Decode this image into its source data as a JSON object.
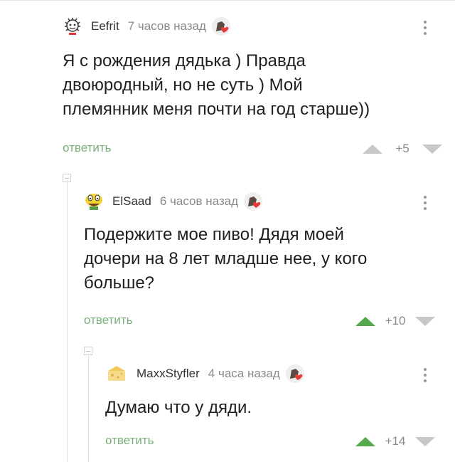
{
  "comments": [
    {
      "author": "Eefrit",
      "time": "7 часов назад",
      "text_lines": [
        "Я с рождения дядька ) Правда",
        "двоюродный, но не суть ) Мой",
        "племянник меня почти на год старше))"
      ],
      "reply_label": "ответить",
      "score": "+5",
      "upvoted": false
    },
    {
      "author": "ElSaad",
      "time": "6 часов назад",
      "text_lines": [
        "Подержите мое пиво! Дядя моей",
        "дочери на 8 лет младше нее, у кого",
        "больше?"
      ],
      "reply_label": "ответить",
      "score": "+10",
      "upvoted": true
    },
    {
      "author": "MaxxStyfler",
      "time": "4 часа назад",
      "text_lines": [
        "Думаю что у дяди."
      ],
      "reply_label": "ответить",
      "score": "+14",
      "upvoted": true
    }
  ],
  "icons": {
    "avatar_1": "avatar-icon",
    "badge": "heart-badge-icon",
    "more": "more-vertical-icon",
    "up": "upvote-arrow-icon",
    "down": "downvote-arrow-icon"
  },
  "colors": {
    "reply": "#7bb07a",
    "upvote_active": "#56a84c",
    "vote_inactive": "#c7c7c7",
    "meta": "#8a8a8a"
  }
}
